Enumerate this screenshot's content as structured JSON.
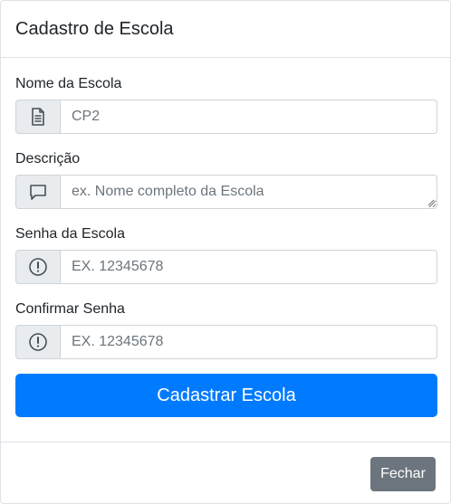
{
  "modal": {
    "title": "Cadastro de Escola"
  },
  "form": {
    "fields": [
      {
        "label": "Nome da Escola",
        "placeholder": "CP2",
        "value": "",
        "icon": "document-icon"
      },
      {
        "label": "Descrição",
        "placeholder": "ex. Nome completo da Escola",
        "value": "",
        "icon": "chat-icon"
      },
      {
        "label": "Senha da Escola",
        "placeholder": "EX. 12345678",
        "value": "",
        "icon": "exclamation-circle-icon"
      },
      {
        "label": "Confirmar Senha",
        "placeholder": "EX. 12345678",
        "value": "",
        "icon": "exclamation-circle-icon"
      }
    ],
    "submit_label": "Cadastrar Escola"
  },
  "footer": {
    "close_label": "Fechar"
  },
  "colors": {
    "primary": "#007bff",
    "secondary": "#6c757d",
    "addon_bg": "#e9ecef",
    "border": "#ced4da"
  }
}
